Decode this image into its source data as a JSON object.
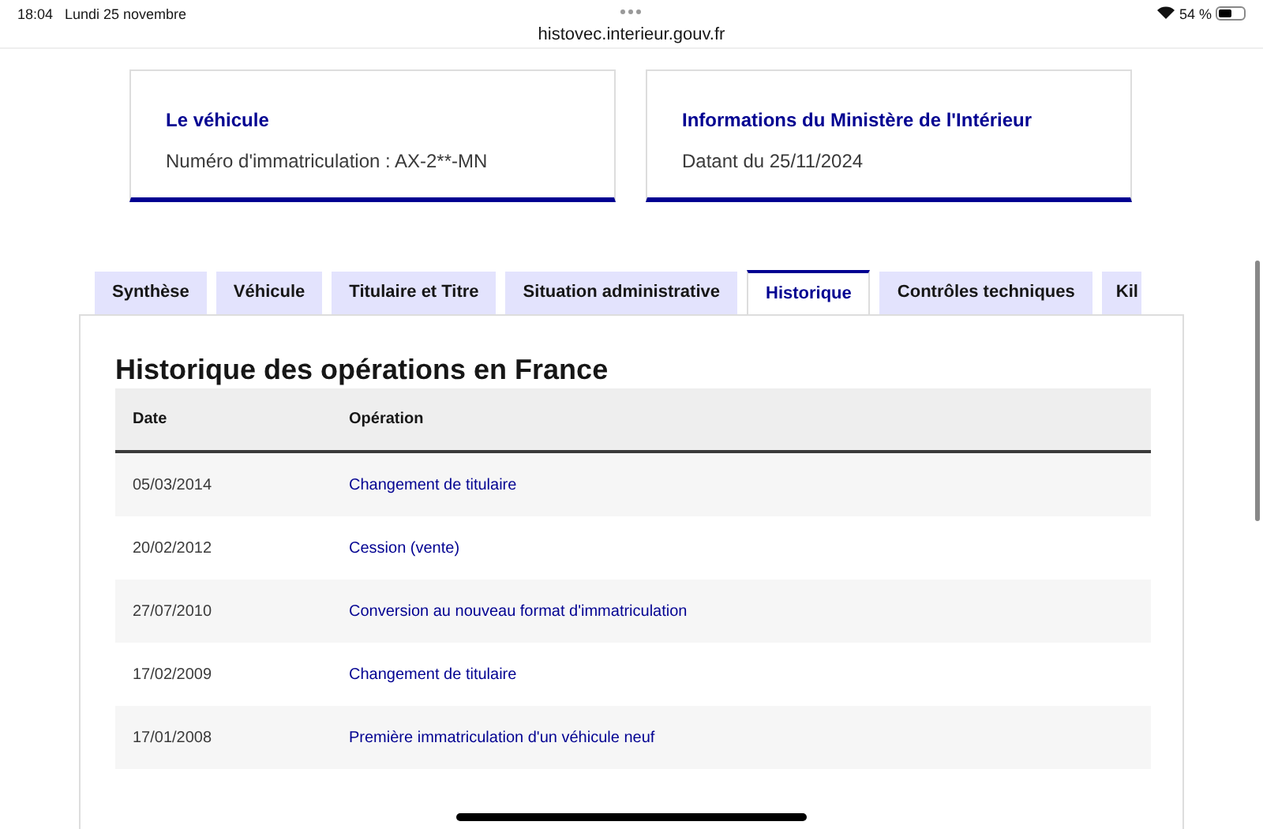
{
  "status_bar": {
    "time": "18:04",
    "date": "Lundi 25 novembre",
    "battery": "54 %"
  },
  "url": "histovec.interieur.gouv.fr",
  "cards": [
    {
      "title": "Le véhicule",
      "text": "Numéro d'immatriculation : AX-2**-MN"
    },
    {
      "title": "Informations du Ministère de l'Intérieur",
      "text": "Datant du 25/11/2024"
    }
  ],
  "tabs": [
    {
      "label": "Synthèse",
      "selected": false
    },
    {
      "label": "Véhicule",
      "selected": false
    },
    {
      "label": "Titulaire et Titre",
      "selected": false
    },
    {
      "label": "Situation administrative",
      "selected": false
    },
    {
      "label": "Historique",
      "selected": true
    },
    {
      "label": "Contrôles techniques",
      "selected": false
    },
    {
      "label": "Kil",
      "selected": false
    }
  ],
  "section": {
    "title": "Historique des opérations en France",
    "table": {
      "columns": [
        "Date",
        "Opération"
      ],
      "rows": [
        [
          "05/03/2014",
          "Changement de titulaire"
        ],
        [
          "20/02/2012",
          "Cession (vente)"
        ],
        [
          "27/07/2010",
          "Conversion au nouveau format d'immatriculation"
        ],
        [
          "17/02/2009",
          "Changement de titulaire"
        ],
        [
          "17/01/2008",
          "Première immatriculation d'un véhicule neuf"
        ]
      ]
    }
  }
}
